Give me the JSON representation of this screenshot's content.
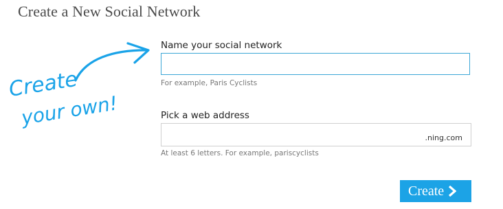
{
  "page": {
    "title": "Create a New Social Network"
  },
  "promo": {
    "line1": "Create",
    "line2": "your own!",
    "color": "#1aa3e8"
  },
  "form": {
    "name_field": {
      "label": "Name your social network",
      "value": "",
      "hint": "For example, Paris Cyclists"
    },
    "address_field": {
      "label": "Pick a web address",
      "value": "",
      "suffix": ".ning.com",
      "hint": "At least 6 letters. For example, pariscyclists"
    },
    "submit": {
      "label": "Create",
      "icon": "chevron-right-icon",
      "color": "#1ca3e6"
    }
  }
}
